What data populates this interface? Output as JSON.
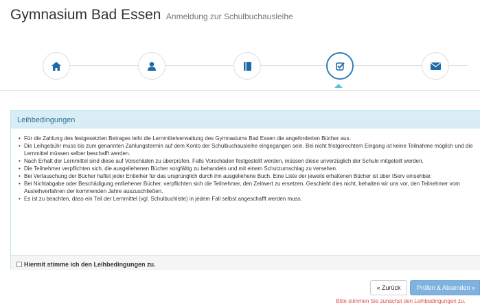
{
  "header": {
    "title": "Gymnasium Bad Essen",
    "subtitle": "Anmeldung zur Schulbuchausleihe"
  },
  "wizard": {
    "steps": [
      {
        "icon": "home-icon"
      },
      {
        "icon": "user-icon"
      },
      {
        "icon": "book-icon"
      },
      {
        "icon": "check-square-icon",
        "active": true
      },
      {
        "icon": "envelope-icon"
      }
    ],
    "colors": {
      "icon": "#1e6aa8",
      "active_border": "#2a7cbf",
      "caret": "#5bc0de"
    }
  },
  "panel": {
    "heading": "Leihbedingungen",
    "items": [
      "Für die Zahlung des festgesetzten Betrages leiht die Lernmittelverwaltung des Gymnasiums Bad Essen die angeforderten Bücher aus.",
      "Die Leihgebühr muss bis zum genannten Zahlungstermin auf dem Konto der Schulbuchausleihe eingegangen sein. Bei nicht fristgerechtem Eingang ist keine Teilnahme möglich und die Lernmittel müssen selber beschafft werden.",
      "Nach Erhalt der Lernmittel sind diese auf Vorschäden zu überprüfen. Falls Vorschäden festgestellt werden, müssen diese unverzüglich der Schule mitgeteilt werden.",
      "Die Teilnehmer verpflichten sich, die ausgeliehenen Bücher sorgfältig zu behandeln und mit einem Schutzumschlag zu versehen.",
      "Bei Vertauschung der Bücher haftet jeder Entleiher für das ursprünglich durch ihn ausgeliehene Buch. Eine Liste der jeweils erhaltenen Bücher ist über IServ einsehbar.",
      "Bei Nichtabgabe oder Beschädigung entliehener Bücher, verpflichten sich die Teilnehmer, den Zeitwert zu ersetzen. Geschieht dies nicht, behalten wir uns vor, den Teilnehmer vom Ausleihverfahren der kommenden Jahre auszuschließen.",
      "Es ist zu beachten, dass ein Teil der Lernmittel (vgl. Schulbuchliste) in jedem Fall selbst angeschafft werden muss."
    ],
    "agree_label": "Hiermit stimme ich den Leihbedingungen zu.",
    "agree_checked": false
  },
  "buttons": {
    "back": "« Zurück",
    "submit": "Prüfen & Absenden »"
  },
  "warning": "Bitte stimmen Sie zunächst den Leihbedingungen zu."
}
